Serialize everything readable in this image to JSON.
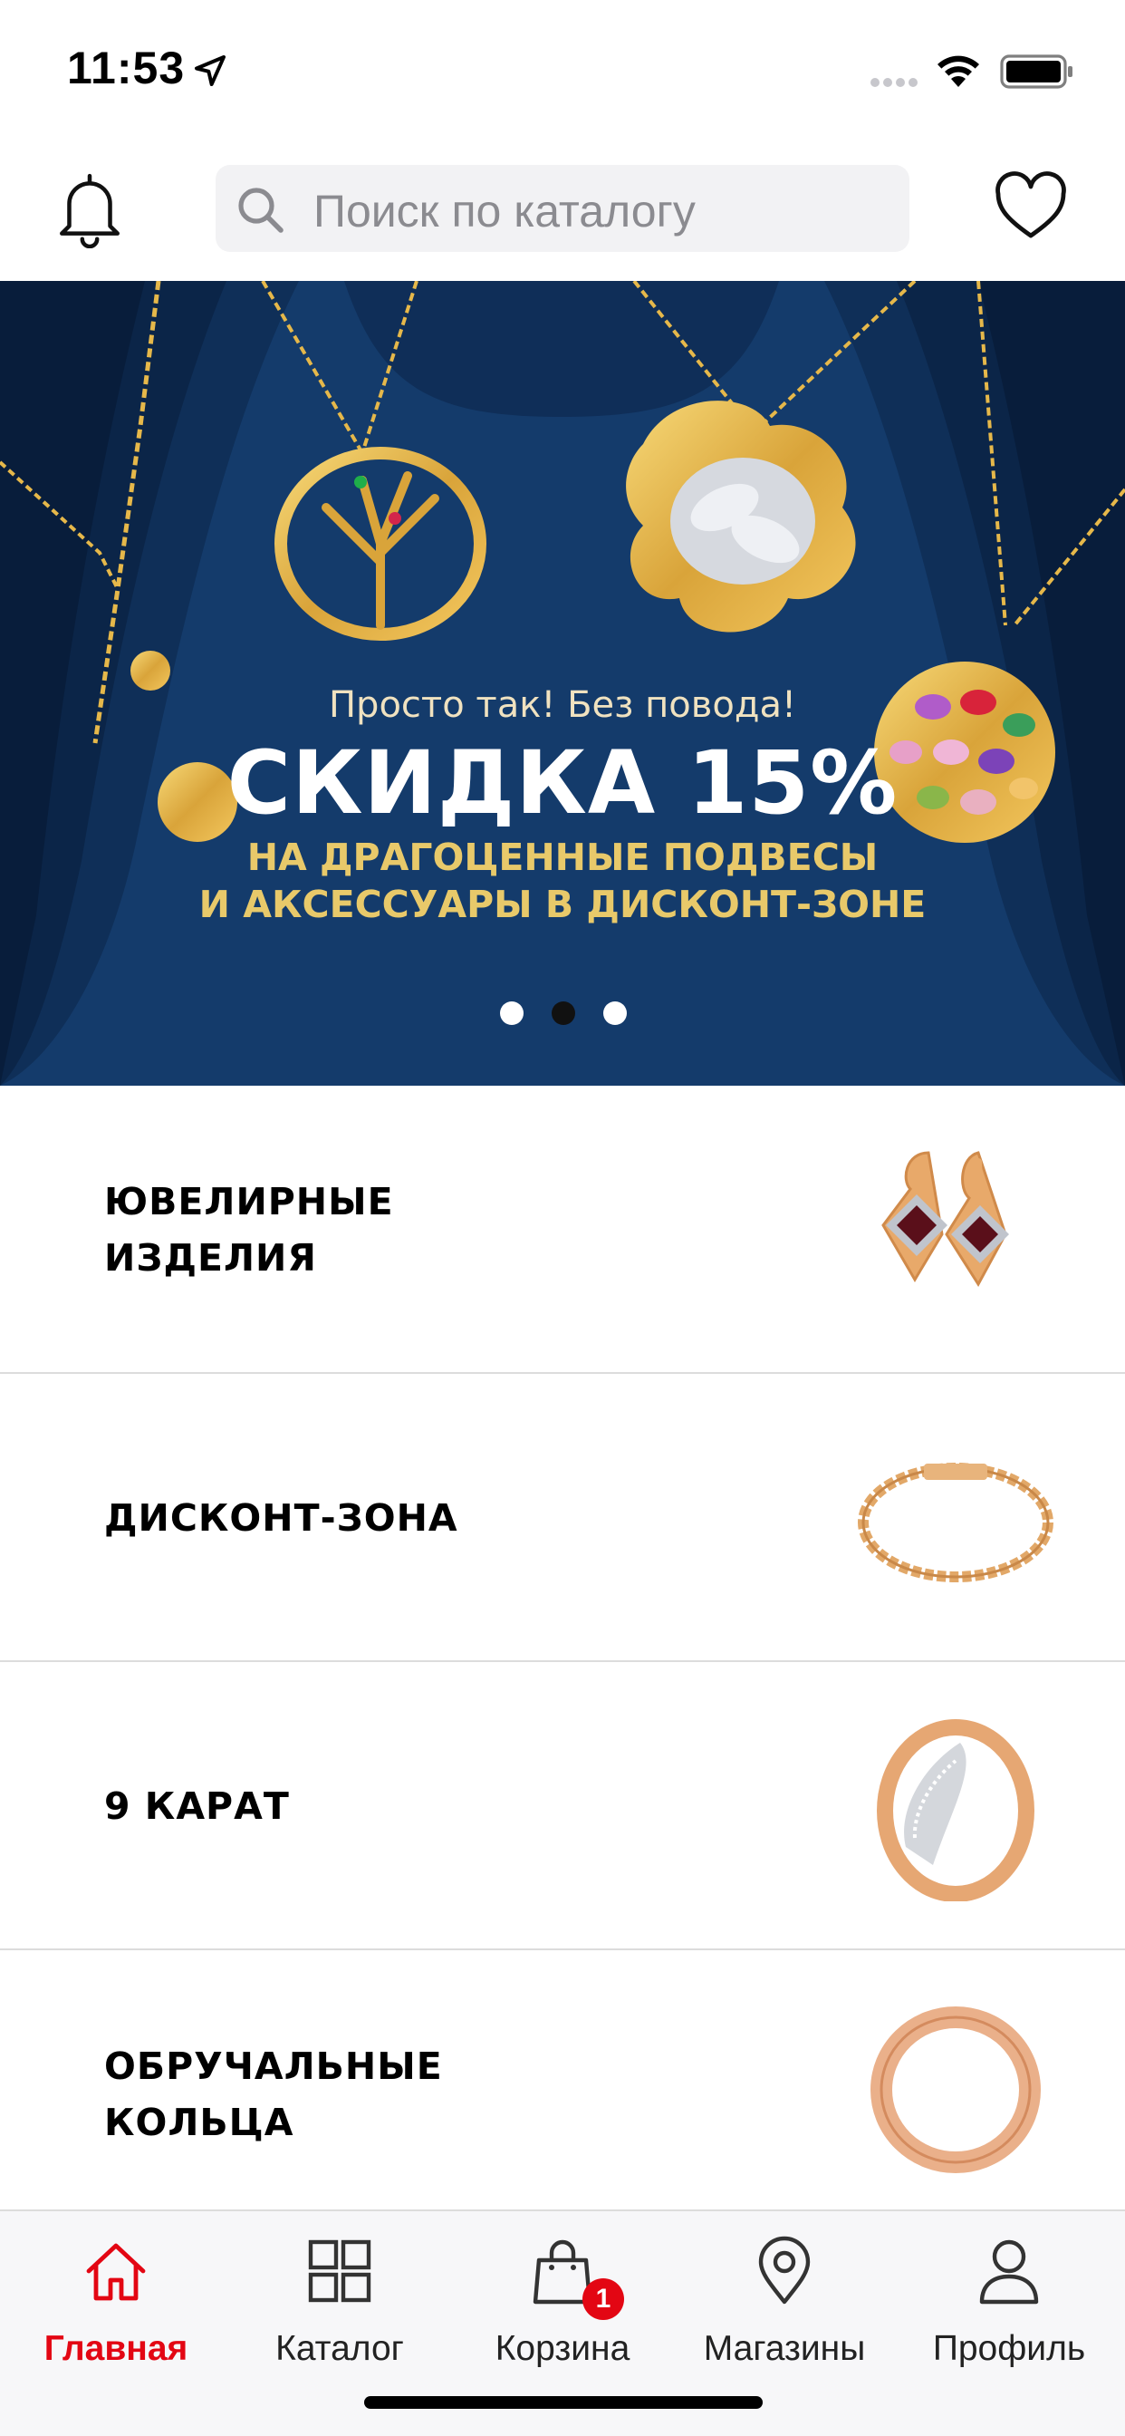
{
  "status_bar": {
    "time": "11:53",
    "icons": [
      "location-arrow-icon",
      "signal-icon",
      "wifi-icon",
      "battery-icon"
    ]
  },
  "header": {
    "search_placeholder": "Поиск по каталогу",
    "icons": [
      "bell-icon",
      "search-icon",
      "heart-icon"
    ]
  },
  "banner": {
    "subtitle": "Просто так! Без повода!",
    "title": "СКИДКА 15%",
    "line1": "НА ДРАГОЦЕННЫЕ ПОДВЕСЫ",
    "line2": "И АКСЕССУАРЫ В ДИСКОНТ-ЗОНЕ",
    "page_count": 3,
    "active_page": 2
  },
  "categories": [
    {
      "label": "ЮВЕЛИРНЫЕ ИЗДЕЛИЯ",
      "image": "earrings"
    },
    {
      "label": "ДИСКОНТ-ЗОНА",
      "image": "bracelet"
    },
    {
      "label": "9 КАРАТ",
      "image": "diamond-ring"
    },
    {
      "label": "ОБРУЧАЛЬНЫЕ КОЛЬЦА",
      "image": "wedding-ring"
    }
  ],
  "tab_bar": {
    "tabs": [
      {
        "label": "Главная",
        "icon": "home-icon",
        "active": true
      },
      {
        "label": "Каталог",
        "icon": "grid-icon",
        "active": false
      },
      {
        "label": "Корзина",
        "icon": "shopping-bag-icon",
        "active": false,
        "badge": "1"
      },
      {
        "label": "Магазины",
        "icon": "map-pin-icon",
        "active": false
      },
      {
        "label": "Профиль",
        "icon": "user-icon",
        "active": false
      }
    ]
  },
  "colors": {
    "accent": "#e30613",
    "banner_bg": "#123968",
    "gold": "#e8c96a"
  }
}
